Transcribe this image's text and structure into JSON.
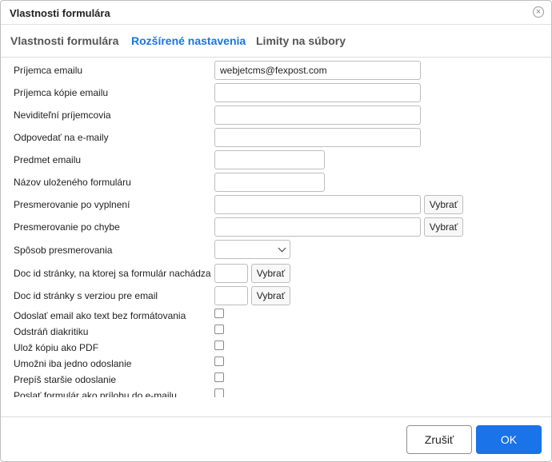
{
  "dialog": {
    "title": "Vlastnosti formulára"
  },
  "tabs": [
    {
      "label": "Vlastnosti formulára",
      "active": false
    },
    {
      "label": "Rozšírené nastavenia",
      "active": true
    },
    {
      "label": "Limity na súbory",
      "active": false
    }
  ],
  "fields": {
    "recipient": {
      "label": "Príjemca emailu",
      "value": "webjetcms@fexpost.com"
    },
    "cc": {
      "label": "Príjemca kópie emailu",
      "value": ""
    },
    "bcc": {
      "label": "Neviditeľní príjemcovia",
      "value": ""
    },
    "reply_to": {
      "label": "Odpovedať na e-maily",
      "value": ""
    },
    "subject": {
      "label": "Predmet emailu",
      "value": ""
    },
    "saved_form_name": {
      "label": "Názov uloženého formuláru",
      "value": ""
    },
    "redirect_success": {
      "label": "Presmerovanie po vyplnení",
      "value": "",
      "button": "Vybrať"
    },
    "redirect_error": {
      "label": "Presmerovanie po chybe",
      "value": "",
      "button": "Vybrať"
    },
    "redirect_method": {
      "label": "Spôsob presmerovania",
      "value": ""
    },
    "doc_id_form": {
      "label": "Doc id stránky, na ktorej sa formulár nachádza",
      "value": "",
      "button": "Vybrať"
    },
    "doc_id_email": {
      "label": "Doc id stránky s verziou pre email",
      "value": "",
      "button": "Vybrať"
    }
  },
  "checkboxes": [
    {
      "label": "Odoslať email ako text bez formátovania",
      "checked": false
    },
    {
      "label": "Odstráň diakritiku",
      "checked": false
    },
    {
      "label": "Ulož kópiu ako PDF",
      "checked": false
    },
    {
      "label": "Umožni iba jedno odoslanie",
      "checked": false
    },
    {
      "label": "Prepíš staršie odoslanie",
      "checked": false
    },
    {
      "label": "Poslať formulár ako prílohu do e-mailu",
      "checked": false
    }
  ],
  "footer": {
    "cancel_label": "Zrušiť",
    "ok_label": "OK"
  },
  "colors": {
    "accent": "#1a73e8",
    "border": "#bdbdbd"
  },
  "icons": {
    "close": "close-icon",
    "dropdown": "chevron-down-icon"
  }
}
